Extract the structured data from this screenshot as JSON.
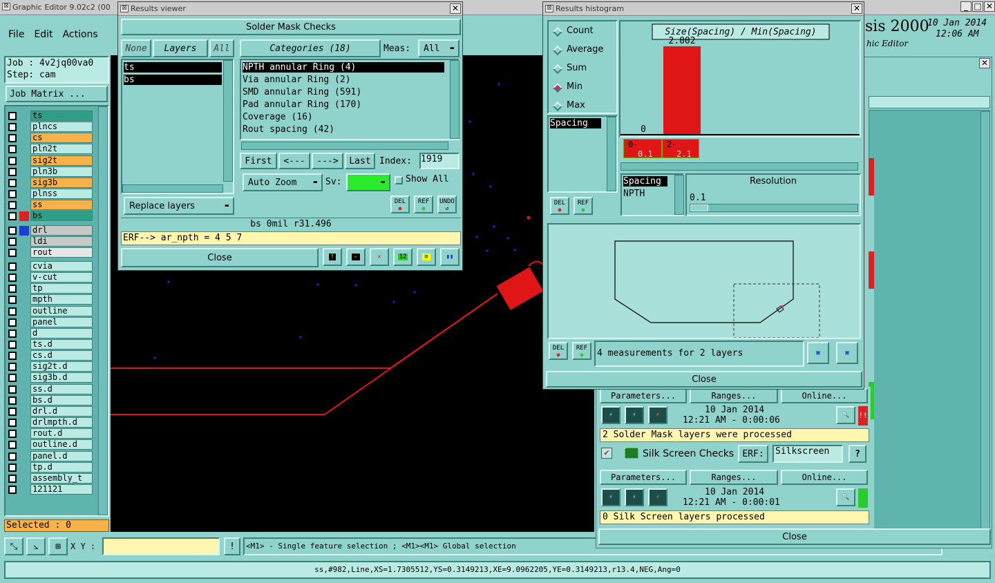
{
  "main_window": {
    "title": "Graphic Editor 9.02c2 (00",
    "menu": [
      "File",
      "Edit",
      "Actions"
    ],
    "job": "Job : 4v2jq00va0",
    "step": "Step: cam",
    "job_matrix": "Job Matrix ...",
    "layers": [
      {
        "name": "ts",
        "color": "#2e9e86",
        "box": ""
      },
      {
        "name": "plncs",
        "color": "#b9ebe4",
        "box": ""
      },
      {
        "name": "cs",
        "color": "#f7b34a",
        "box": ""
      },
      {
        "name": "pln2t",
        "color": "#b9ebe4",
        "box": ""
      },
      {
        "name": "sig2t",
        "color": "#f7b34a",
        "box": ""
      },
      {
        "name": "pln3b",
        "color": "#b9ebe4",
        "box": ""
      },
      {
        "name": "sig3b",
        "color": "#f7b34a",
        "box": ""
      },
      {
        "name": "plnss",
        "color": "#b9ebe4",
        "box": ""
      },
      {
        "name": "ss",
        "color": "#f7b34a",
        "box": ""
      },
      {
        "name": "bs",
        "color": "#2e9e86",
        "box": "#e02020"
      },
      {
        "name": "drl",
        "color": "#c8c8c8",
        "box": "#1a3fd6"
      },
      {
        "name": "ldi",
        "color": "#c8c8c8",
        "box": ""
      },
      {
        "name": "rout",
        "color": "#e6e6e6",
        "box": ""
      },
      {
        "name": "cvia",
        "color": "#b9ebe4",
        "box": ""
      },
      {
        "name": "v-cut",
        "color": "#b9ebe4",
        "box": ""
      },
      {
        "name": "tp",
        "color": "#b9ebe4",
        "box": ""
      },
      {
        "name": "mpth",
        "color": "#b9ebe4",
        "box": ""
      },
      {
        "name": "outline",
        "color": "#b9ebe4",
        "box": ""
      },
      {
        "name": "panel",
        "color": "#b9ebe4",
        "box": ""
      },
      {
        "name": "d",
        "color": "#b9ebe4",
        "box": ""
      },
      {
        "name": "ts.d",
        "color": "#b9ebe4",
        "box": ""
      },
      {
        "name": "cs.d",
        "color": "#b9ebe4",
        "box": ""
      },
      {
        "name": "sig2t.d",
        "color": "#b9ebe4",
        "box": ""
      },
      {
        "name": "sig3b.d",
        "color": "#b9ebe4",
        "box": ""
      },
      {
        "name": "ss.d",
        "color": "#b9ebe4",
        "box": ""
      },
      {
        "name": "bs.d",
        "color": "#b9ebe4",
        "box": ""
      },
      {
        "name": "drl.d",
        "color": "#b9ebe4",
        "box": ""
      },
      {
        "name": "drlmpth.d",
        "color": "#b9ebe4",
        "box": ""
      },
      {
        "name": "rout.d",
        "color": "#b9ebe4",
        "box": ""
      },
      {
        "name": "outline.d",
        "color": "#b9ebe4",
        "box": ""
      },
      {
        "name": "panel.d",
        "color": "#b9ebe4",
        "box": ""
      },
      {
        "name": "tp.d",
        "color": "#b9ebe4",
        "box": ""
      },
      {
        "name": "assembly_t",
        "color": "#b9ebe4",
        "box": ""
      },
      {
        "name": "121121",
        "color": "#b9ebe4",
        "box": ""
      }
    ],
    "selected": "Selected : 0",
    "xy_label": "X Y :",
    "xy_value": "",
    "hint": "<M1> - Single feature selection ; <M1><M1> Global selection",
    "status": "ss,#982,Line,XS=1.7305512,YS=0.3149213,XE=9.0962205,YE=0.3149213,r13.4,NEG,Ang=0",
    "brand": "sis 2000",
    "brand_sub": "hic Editor",
    "date": "10 Jan 2014",
    "time": "12:06 AM"
  },
  "results_viewer": {
    "title": "Results viewer",
    "header": "Solder Mask Checks",
    "none_btn": "None",
    "layers_btn": "Layers",
    "all_btn": "All",
    "layers": [
      "ts",
      "bs"
    ],
    "categories_btn": "Categories (18)",
    "meas_label": "Meas:",
    "meas_value": "All",
    "categories": [
      "NPTH annular Ring (4)",
      "Via annular Ring (2)",
      "SMD annular Ring (591)",
      "Pad annular Ring (170)",
      "Coverage (16)",
      "Rout spacing (42)"
    ],
    "first": "First",
    "prev": "<---",
    "next": "--->",
    "last": "Last",
    "index_label": "Index:",
    "index_value": "1919",
    "auto_zoom": "Auto Zoom",
    "sv_label": "Sv:",
    "show_all": "Show All",
    "replace_layers": "Replace layers",
    "del": "DEL",
    "ref": "REF",
    "undo": "UNDO",
    "status": "bs 0mil  r31.496",
    "erf": "ERF--> ar_npth = 4 5 7",
    "close": "Close"
  },
  "histogram": {
    "title": "Results histogram",
    "options": [
      "Count",
      "Average",
      "Sum",
      "Min",
      "Max"
    ],
    "selected_option": "Min",
    "chart_title": "Size(Spacing) / Min(Spacing)",
    "bar_label": "2.002",
    "zero_label": "0",
    "range1_a": "0-",
    "range1_b": "0.1",
    "range2_a": "2-",
    "range2_b": "2.1",
    "measure_list": [
      "Spacing"
    ],
    "type_list": [
      "Spacing",
      "NPTH"
    ],
    "resolution_label": "Resolution",
    "resolution_value": "0.1",
    "del": "DEL",
    "ref": "REF",
    "measurements": "4 measurements for 2 layers",
    "close": "Close",
    "chart_data": {
      "type": "bar",
      "categories": [
        "0-0.1",
        "2-2.1"
      ],
      "values": [
        0,
        2.002
      ],
      "title": "Size(Spacing) / Min(Spacing)",
      "ylim": [
        0,
        2.002
      ]
    }
  },
  "checklist": {
    "params": "Parameters...",
    "ranges": "Ranges...",
    "online": "Online...",
    "row1_date": "10 Jan 2014",
    "row1_time": "12:21 AM - 0:00:06",
    "row1_msg": "2 Solder Mask layers were processed",
    "silk_title": "Silk Screen Checks",
    "erf_btn": "ERF:",
    "erf_value": "Silkscreen",
    "help": "?",
    "row2_date": "10 Jan 2014",
    "row2_time": "12:21 AM - 0:00:01",
    "row2_msg": "0 Silk Screen layers processed",
    "close": "Close"
  },
  "colors": {
    "teal": "#8fd3cc",
    "canvas": "#000000",
    "trace": "#e01515",
    "dot": "#1a2bff",
    "status_yellow": "#fff6b0"
  }
}
